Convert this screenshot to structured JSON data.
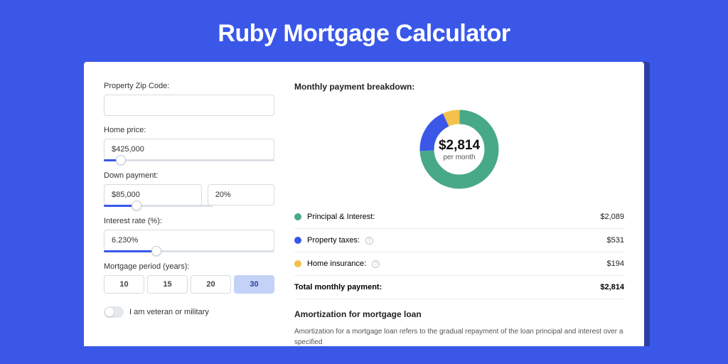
{
  "title": "Ruby Mortgage Calculator",
  "form": {
    "zip_label": "Property Zip Code:",
    "zip_value": "",
    "price_label": "Home price:",
    "price_value": "$425,000",
    "down_label": "Down payment:",
    "down_value": "$85,000",
    "down_pct": "20%",
    "rate_label": "Interest rate (%):",
    "rate_value": "6.230%",
    "period_label": "Mortgage period (years):",
    "periods": [
      "10",
      "15",
      "20",
      "30"
    ],
    "period_active_index": 3,
    "veteran_label": "I am veteran or military",
    "veteran_on": false
  },
  "breakdown": {
    "title": "Monthly payment breakdown:",
    "center_value": "$2,814",
    "center_sub": "per month",
    "rows": [
      {
        "label": "Principal & Interest:",
        "value": "$2,089",
        "color": "green",
        "info": false
      },
      {
        "label": "Property taxes:",
        "value": "$531",
        "color": "blue",
        "info": true
      },
      {
        "label": "Home insurance:",
        "value": "$194",
        "color": "yellow",
        "info": true
      }
    ],
    "total_label": "Total monthly payment:",
    "total_value": "$2,814"
  },
  "amort": {
    "title": "Amortization for mortgage loan",
    "text": "Amortization for a mortgage loan refers to the gradual repayment of the loan principal and interest over a specified"
  },
  "chart_data": {
    "type": "pie",
    "title": "Monthly payment breakdown",
    "series": [
      {
        "name": "Principal & Interest",
        "value": 2089,
        "color": "#48a988"
      },
      {
        "name": "Property taxes",
        "value": 531,
        "color": "#3a57e8"
      },
      {
        "name": "Home insurance",
        "value": 194,
        "color": "#f3c24a"
      }
    ],
    "total": 2814,
    "unit": "USD per month"
  }
}
